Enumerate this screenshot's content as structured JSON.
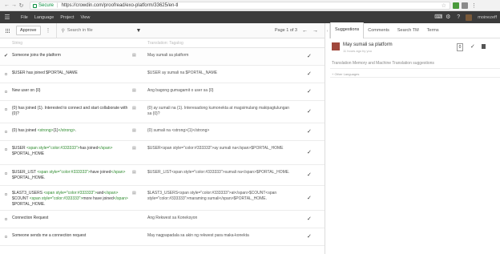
{
  "browser": {
    "secure_label": "Secure",
    "url": "https://crowdin.com/proofread/exo-platform/33625/en-tl"
  },
  "app_menu": {
    "items": [
      "File",
      "Language",
      "Project",
      "View"
    ],
    "username": "moinezeff"
  },
  "toolbar": {
    "approve_label": "Approve",
    "search_placeholder": "Search in file",
    "page_label": "Page 1 of 3"
  },
  "columns": {
    "string": "String",
    "translation": "Translation: Tagalog"
  },
  "rows": [
    {
      "source": "Someone joins the platform",
      "translation": "May sumali sa platform",
      "comment": true,
      "active": true
    },
    {
      "source": "$USER has joined $PORTAL_NAME",
      "translation": "$USER ay sumali na $PORTAL_NAME",
      "comment": false
    },
    {
      "source": "New user on {0}",
      "translation": "Ang bagong gumagamit o user sa {0}",
      "comment": true
    },
    {
      "source": "{0} has joined {1}. Interested to connect and start collaborate with {0}?",
      "translation": "{0} ay sumali na {1}. Interesadong kumonekta at magsimulang makipagtulungan sa {0}?",
      "comment": true
    },
    {
      "source": "{0} has joined <strong>{1}</strong>.",
      "translation": "{0} sumali na <strong>{1}</strong>",
      "comment": true
    },
    {
      "source": "$USER <span style=\"color:#333333\">has joined</span> $PORTAL_HOME",
      "translation": "$USER<span style=\"color:#333333\">ay sumali na</span>$PORTAL_HOME",
      "comment": true
    },
    {
      "source": "$USER_LIST <span style=\"color:#333333\">have joined</span> $PORTAL_HOME.",
      "translation": "$USER_LIST<span style=\"color:#333333\">sumali na</span>$PORTAL_HOME.",
      "comment": true
    },
    {
      "source": "$LAST3_USERS <span style=\"color:#333333\">and</span> $COUNT <span style=\"color:#333333\">more have joined</span> $PORTAL_HOME.",
      "translation": "$LAST3_USERS<span style=\"color:#333333\">at</span>$COUNT<span style=\"color:#333333\">maraming sumali</span>$PORTAL_HOME.",
      "comment": true
    },
    {
      "source": "Connection Request",
      "translation": "Ang Rekwest sa Koneksyon",
      "comment": false
    },
    {
      "source": "Someone sends me a connection request",
      "translation": "May nagpapadala sa akin ng rekwest para maka-konekta",
      "comment": false
    }
  ],
  "panel": {
    "tabs": [
      "Suggestions",
      "Comments",
      "Search TM",
      "Terms"
    ],
    "suggestion_text": "May sumali sa platform",
    "suggestion_meta": "11 hours ago by you",
    "vote_count": "0",
    "tm_heading": "Translation Memory and Machine Translation suggestions",
    "other_languages": "+ Other Languages"
  },
  "colors": {
    "header_bg": "#3b3b3b",
    "tag_green": "#2e8b2e",
    "secure_green": "#0a8f3f"
  },
  "icons": {
    "back": "arrow-left-icon",
    "forward": "arrow-right-icon",
    "reload": "reload-icon",
    "lock": "lock-icon",
    "star": "star-icon",
    "filter": "filter-icon",
    "check": "check-icon",
    "delete": "trash-icon"
  }
}
